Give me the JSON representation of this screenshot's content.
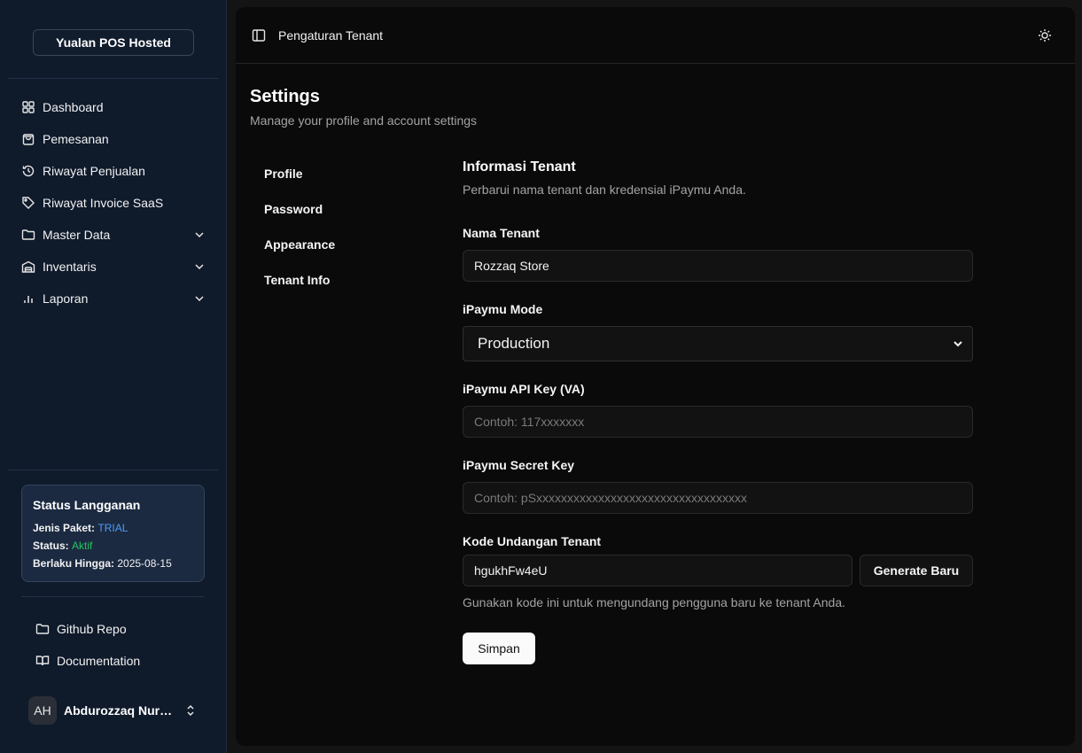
{
  "sidebar": {
    "brand": "Yualan POS Hosted",
    "items": [
      {
        "label": "Dashboard",
        "icon": "grid-icon"
      },
      {
        "label": "Pemesanan",
        "icon": "shopping-bag-icon"
      },
      {
        "label": "Riwayat Penjualan",
        "icon": "history-icon"
      },
      {
        "label": "Riwayat Invoice SaaS",
        "icon": "tag-icon"
      },
      {
        "label": "Master Data",
        "icon": "folder-icon",
        "expandable": true
      },
      {
        "label": "Inventaris",
        "icon": "warehouse-icon",
        "expandable": true
      },
      {
        "label": "Laporan",
        "icon": "bar-chart-icon",
        "expandable": true
      }
    ],
    "subscription": {
      "title": "Status Langganan",
      "plan_label": "Jenis Paket:",
      "plan_value": "TRIAL",
      "status_label": "Status:",
      "status_value": "Aktif",
      "valid_label": "Berlaku Hingga:",
      "valid_value": "2025-08-15"
    },
    "footer_items": [
      {
        "label": "Github Repo",
        "icon": "folder-icon"
      },
      {
        "label": "Documentation",
        "icon": "book-open-icon"
      }
    ],
    "user": {
      "initials": "AH",
      "name": "Abdurozzaq Nurul Hadi"
    }
  },
  "header": {
    "breadcrumb": "Pengaturan Tenant"
  },
  "page": {
    "title": "Settings",
    "subtitle": "Manage your profile and account settings"
  },
  "tabs": [
    "Profile",
    "Password",
    "Appearance",
    "Tenant Info"
  ],
  "form": {
    "title": "Informasi Tenant",
    "subtitle": "Perbarui nama tenant dan kredensial iPaymu Anda.",
    "tenant_name_label": "Nama Tenant",
    "tenant_name_value": "Rozzaq Store",
    "mode_label": "iPaymu Mode",
    "mode_value": "Production",
    "api_key_label": "iPaymu API Key (VA)",
    "api_key_placeholder": "Contoh: 117xxxxxxx",
    "secret_label": "iPaymu Secret Key",
    "secret_placeholder": "Contoh: pSxxxxxxxxxxxxxxxxxxxxxxxxxxxxxxxxxx",
    "invite_label": "Kode Undangan Tenant",
    "invite_value": "hgukhFw4eU",
    "generate_label": "Generate Baru",
    "invite_hint": "Gunakan kode ini untuk mengundang pengguna baru ke tenant Anda.",
    "save_label": "Simpan"
  },
  "colors": {
    "sidebar_bg": "#0f1a2b",
    "main_bg": "#0a0a0a",
    "plan_accent": "#4d9cf8",
    "status_accent": "#22c55e"
  }
}
